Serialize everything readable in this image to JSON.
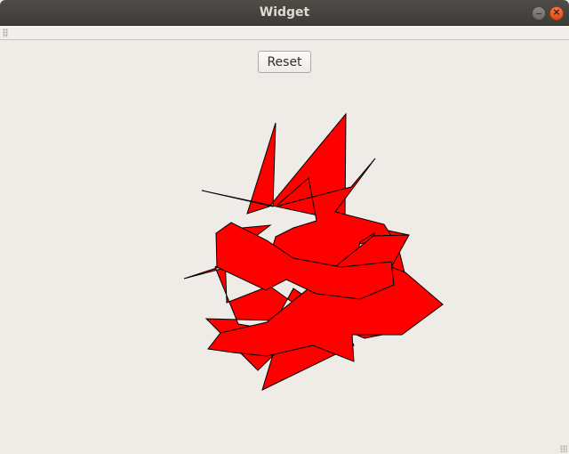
{
  "window": {
    "title": "Widget",
    "minimize_icon": "minimize-icon",
    "close_icon": "close-icon"
  },
  "toolbar": {
    "reset_label": "Reset"
  },
  "drawing": {
    "fill_color": "#ff0000",
    "stroke_color": "#000000",
    "background_color": "#efebe7",
    "shape": "self-intersecting-polygon"
  }
}
